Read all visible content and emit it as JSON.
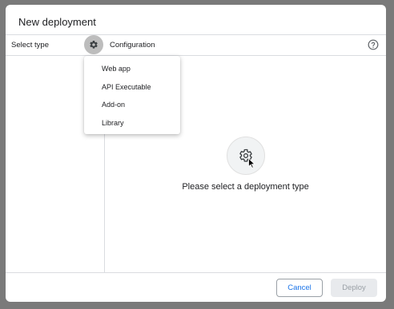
{
  "dialog": {
    "title": "New deployment"
  },
  "header": {
    "select_type_label": "Select type",
    "config_label": "Configuration",
    "gear_icon": "gear-icon",
    "help_icon": "help-circle-icon"
  },
  "type_menu": {
    "items": [
      {
        "label": "Web app"
      },
      {
        "label": "API Executable"
      },
      {
        "label": "Add-on"
      },
      {
        "label": "Library"
      }
    ]
  },
  "empty_state": {
    "icon": "gear-icon",
    "message": "Please select a deployment type"
  },
  "footer": {
    "cancel_label": "Cancel",
    "deploy_label": "Deploy"
  },
  "colors": {
    "accent": "#1a73e8",
    "divider": "#dadce0",
    "disabled_bg": "#e8eaed"
  }
}
